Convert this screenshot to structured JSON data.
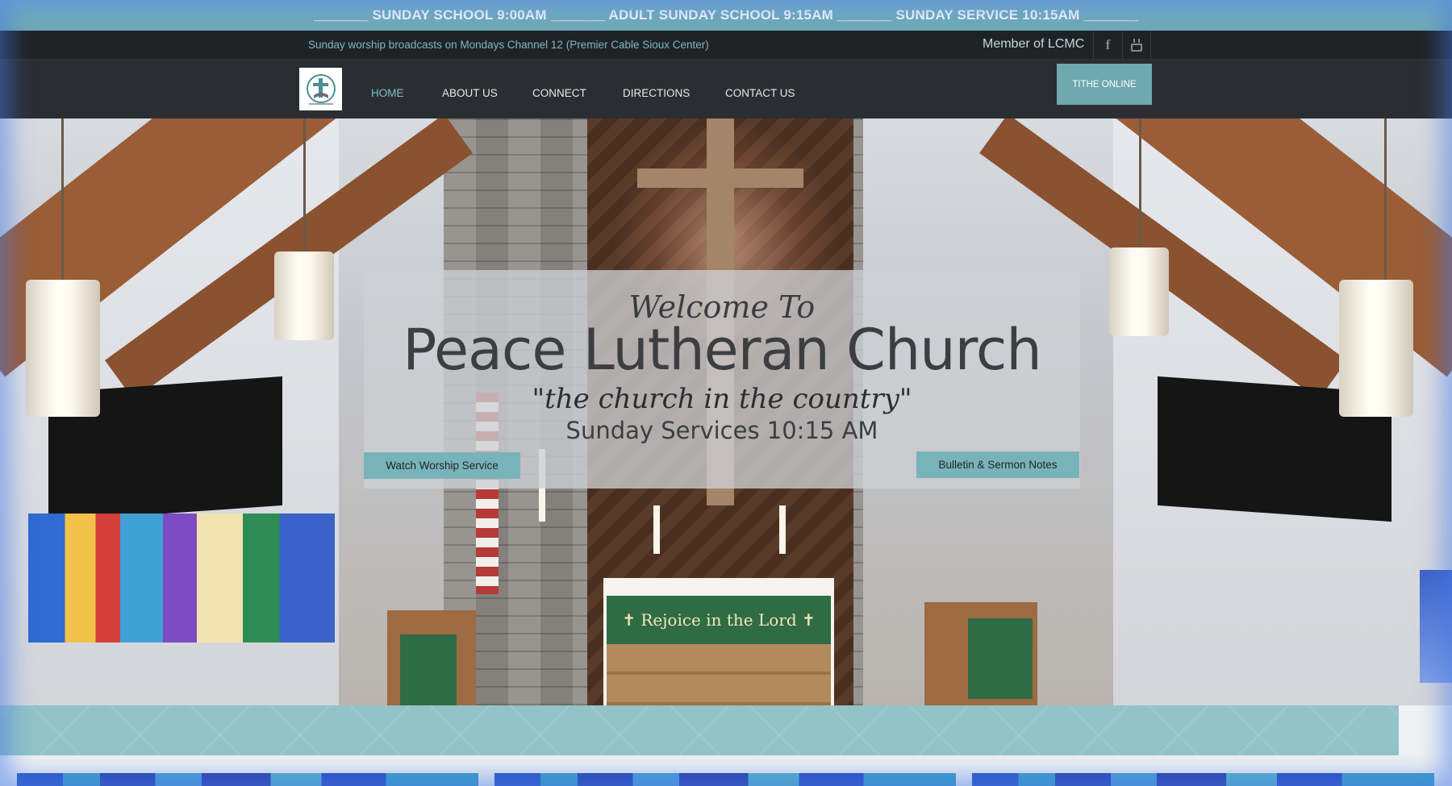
{
  "announcement": {
    "text": "_______ SUNDAY SCHOOL 9:00AM _______ ADULT SUNDAY SCHOOL 9:15AM _______ SUNDAY SERVICE 10:15AM _______"
  },
  "utility_bar": {
    "broadcast_text": "Sunday worship broadcasts on Mondays Channel 12 (Premier Cable Sioux Center)",
    "member_text": "Member of LCMC",
    "social": [
      {
        "icon": "facebook-icon",
        "glyph": "f"
      },
      {
        "icon": "youtube-icon",
        "glyph": "You"
      }
    ]
  },
  "nav": {
    "logo_icon": "church-logo-icon",
    "items": [
      {
        "label": "HOME",
        "active": true
      },
      {
        "label": "ABOUT US",
        "active": false
      },
      {
        "label": "CONNECT",
        "active": false
      },
      {
        "label": "DIRECTIONS",
        "active": false
      },
      {
        "label": "CONTACT US",
        "active": false
      }
    ],
    "tithe_label": "TITHE ONLINE"
  },
  "hero": {
    "welcome_script": "Welcome To",
    "church_name": "Peace Lutheran Church",
    "tagline": "\"the church in the country\"",
    "services": "Sunday Services 10:15 AM",
    "watch_button": "Watch Worship Service",
    "bulletin_button": "Bulletin & Sermon Notes",
    "altar_text": "✝ Rejoice in the Lord ✝"
  },
  "colors": {
    "accent": "#7fb7bf",
    "nav_bg": "#2a2e32",
    "utility_bg": "#1f2326",
    "button_bg": "#79b3ba"
  }
}
